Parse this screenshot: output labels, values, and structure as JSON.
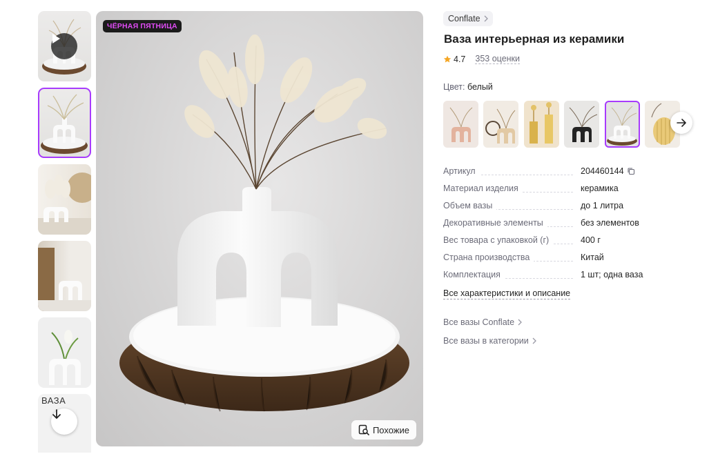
{
  "gallery": {
    "promo_badge": "ЧЁРНАЯ ПЯТНИЦА",
    "similar_button": "Похожие",
    "thumbnail_text": "ВАЗА"
  },
  "product": {
    "brand": "Conflate",
    "title": "Ваза интерьерная из керамики",
    "rating": "4.7",
    "reviews": "353 оценки",
    "color_label": "Цвет:",
    "color_value": "белый"
  },
  "specs": [
    {
      "name": "Артикул",
      "value": "204460144"
    },
    {
      "name": "Материал изделия",
      "value": "керамика"
    },
    {
      "name": "Объем вазы",
      "value": "до 1 литра"
    },
    {
      "name": "Декоративные элементы",
      "value": "без элементов"
    },
    {
      "name": "Вес товара с упаковкой (г)",
      "value": "400 г"
    },
    {
      "name": "Страна производства",
      "value": "Китай"
    },
    {
      "name": "Комплектация",
      "value": "1 шт; одна ваза"
    }
  ],
  "links": {
    "all_specs": "Все характеристики и описание",
    "all_brand": "Все вазы Conflate",
    "all_category": "Все вазы в категории"
  },
  "colors": {
    "accent": "#a73afd",
    "promo_text": "#e04cf5",
    "star": "#f5a623"
  }
}
